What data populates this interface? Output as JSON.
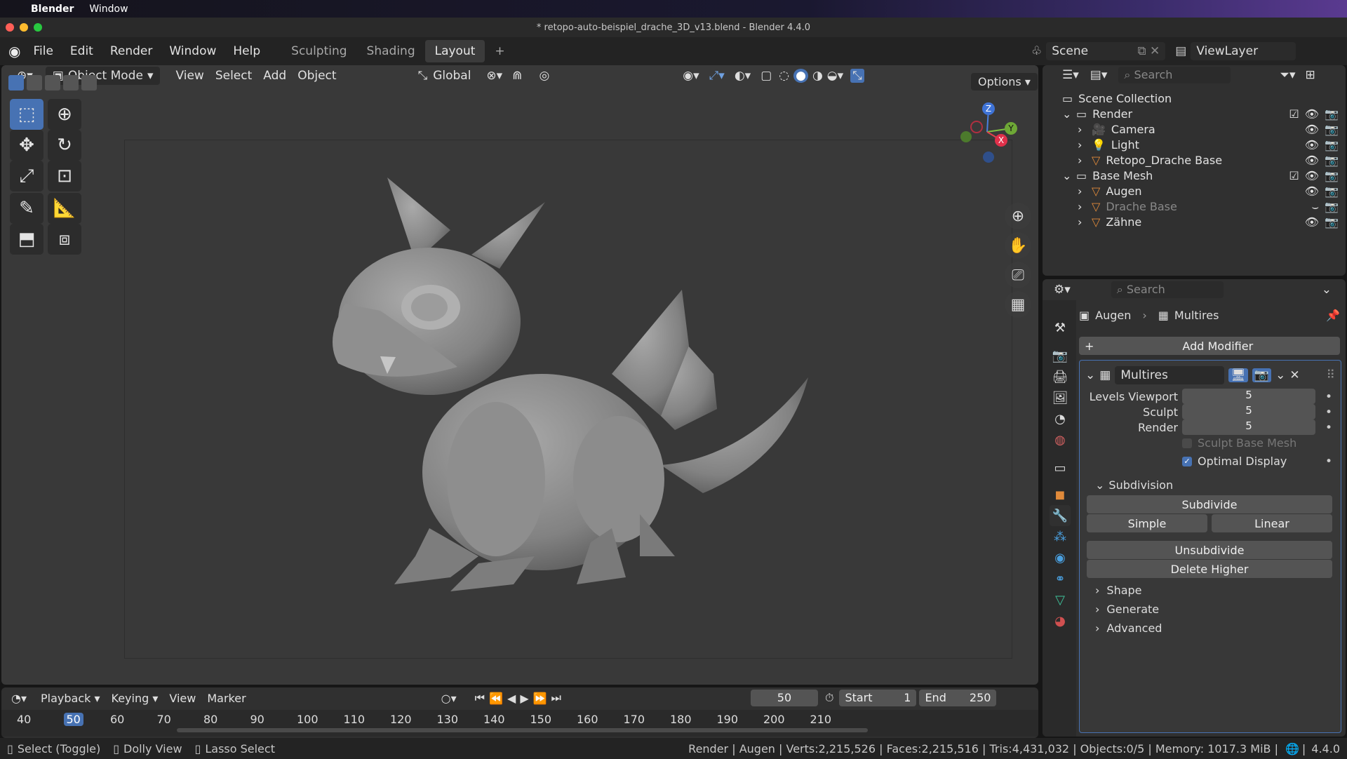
{
  "mac": {
    "apple": "",
    "app": "Blender",
    "menu": "Window"
  },
  "window_title": "* retopo-auto-beispiel_drache_3D_v13.blend - Blender 4.4.0",
  "menus": [
    "File",
    "Edit",
    "Render",
    "Window",
    "Help"
  ],
  "workspaces": [
    "Sculpting",
    "Shading",
    "Layout"
  ],
  "add_workspace": "+",
  "scene": {
    "label": "Scene",
    "viewlayer": "ViewLayer"
  },
  "viewport": {
    "mode": "Object Mode",
    "menus": [
      "View",
      "Select",
      "Add",
      "Object"
    ],
    "orientation": "Global",
    "options": "Options",
    "gizmo": {
      "z": "Z",
      "y": "Y",
      "x": "X"
    }
  },
  "outliner": {
    "search_placeholder": "Search",
    "scene_collection": "Scene Collection",
    "rows": [
      {
        "label": "Render",
        "kind": "collection",
        "level": 1
      },
      {
        "label": "Camera",
        "kind": "camera",
        "level": 2
      },
      {
        "label": "Light",
        "kind": "light",
        "level": 2
      },
      {
        "label": "Retopo_Drache Base",
        "kind": "mesh",
        "level": 2
      },
      {
        "label": "Base Mesh",
        "kind": "collection",
        "level": 1
      },
      {
        "label": "Augen",
        "kind": "mesh",
        "level": 2
      },
      {
        "label": "Drache Base",
        "kind": "mesh",
        "level": 2,
        "dim": true
      },
      {
        "label": "Zähne",
        "kind": "mesh",
        "level": 2
      }
    ]
  },
  "properties": {
    "search_placeholder": "Search",
    "breadcrumb_object": "Augen",
    "breadcrumb_modifier": "Multires",
    "add_modifier": "Add Modifier",
    "modifier_name": "Multires",
    "levels_viewport_label": "Levels Viewport",
    "levels_viewport": "5",
    "sculpt_label": "Sculpt",
    "sculpt": "5",
    "render_label": "Render",
    "render": "5",
    "sculpt_base_mesh": "Sculpt Base Mesh",
    "optimal_display": "Optimal Display",
    "subdivision": "Subdivision",
    "subdivide": "Subdivide",
    "simple": "Simple",
    "linear": "Linear",
    "unsubdivide": "Unsubdivide",
    "delete_higher": "Delete Higher",
    "shape": "Shape",
    "generate": "Generate",
    "advanced": "Advanced"
  },
  "timeline": {
    "menus": [
      "Playback",
      "Keying",
      "View",
      "Marker"
    ],
    "current_frame": "50",
    "start_label": "Start",
    "start": "1",
    "end_label": "End",
    "end": "250",
    "ticks": [
      "40",
      "50",
      "60",
      "70",
      "80",
      "90",
      "100",
      "110",
      "120",
      "130",
      "140",
      "150",
      "160",
      "170",
      "180",
      "190",
      "200",
      "210"
    ]
  },
  "status": {
    "select": "Select (Toggle)",
    "dolly": "Dolly View",
    "lasso": "Lasso Select",
    "stats": "Render | Augen | Verts:2,215,526 | Faces:2,215,516 | Tris:4,431,032 | Objects:0/5 | Memory: 1017.3 MiB |",
    "version": "4.4.0"
  }
}
